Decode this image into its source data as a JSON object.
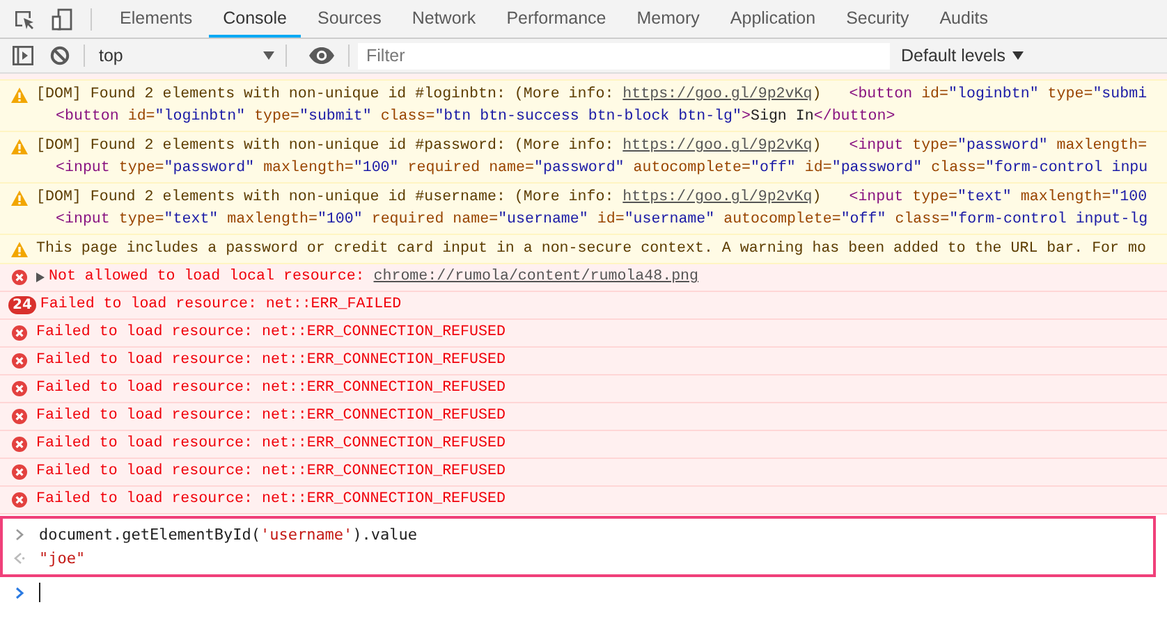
{
  "tabs": [
    {
      "label": "Elements",
      "selected": false
    },
    {
      "label": "Console",
      "selected": true
    },
    {
      "label": "Sources",
      "selected": false
    },
    {
      "label": "Network",
      "selected": false
    },
    {
      "label": "Performance",
      "selected": false
    },
    {
      "label": "Memory",
      "selected": false
    },
    {
      "label": "Application",
      "selected": false
    },
    {
      "label": "Security",
      "selected": false
    },
    {
      "label": "Audits",
      "selected": false
    }
  ],
  "toolbar": {
    "context": "top",
    "filter": {
      "placeholder": "Filter"
    },
    "levels": "Default levels"
  },
  "messages": [
    {
      "kind": "warning",
      "text": "[DOM] Found 2 elements with non-unique id #loginbtn: (More info: ",
      "link": "https://goo.gl/9p2vKq",
      "after_link": ")",
      "snippet": "<button id=\"loginbtn\" type=\"submi",
      "detail": "<button id=\"loginbtn\" type=\"submit\" class=\"btn btn-success btn-block btn-lg\">Sign In</button>"
    },
    {
      "kind": "warning",
      "text": "[DOM] Found 2 elements with non-unique id #password: (More info: ",
      "link": "https://goo.gl/9p2vKq",
      "after_link": ")",
      "snippet": "<input type=\"password\" maxlength=",
      "detail": "<input type=\"password\" maxlength=\"100\" required name=\"password\" autocomplete=\"off\" id=\"password\" class=\"form-control inpu"
    },
    {
      "kind": "warning",
      "text": "[DOM] Found 2 elements with non-unique id #username: (More info: ",
      "link": "https://goo.gl/9p2vKq",
      "after_link": ")",
      "snippet": "<input type=\"text\" maxlength=\"100",
      "detail": "<input type=\"text\" maxlength=\"100\" required name=\"username\" id=\"username\" autocomplete=\"off\" class=\"form-control input-lg"
    },
    {
      "kind": "warning",
      "text": "This page includes a password or credit card input in a non-secure context. A warning has been added to the URL bar. For mo"
    },
    {
      "kind": "error",
      "expanded": false,
      "text": "Not allowed to load local resource: ",
      "link": "chrome://rumola/content/rumola48.png"
    },
    {
      "kind": "error",
      "count": "24",
      "text": "Failed to load resource: net::ERR_FAILED"
    },
    {
      "kind": "error",
      "text": "Failed to load resource: net::ERR_CONNECTION_REFUSED"
    },
    {
      "kind": "error",
      "text": "Failed to load resource: net::ERR_CONNECTION_REFUSED"
    },
    {
      "kind": "error",
      "text": "Failed to load resource: net::ERR_CONNECTION_REFUSED"
    },
    {
      "kind": "error",
      "text": "Failed to load resource: net::ERR_CONNECTION_REFUSED"
    },
    {
      "kind": "error",
      "text": "Failed to load resource: net::ERR_CONNECTION_REFUSED"
    },
    {
      "kind": "error",
      "text": "Failed to load resource: net::ERR_CONNECTION_REFUSED"
    },
    {
      "kind": "error",
      "text": "Failed to load resource: net::ERR_CONNECTION_REFUSED"
    }
  ],
  "evaluation": {
    "highlighted": true,
    "command": "document.getElementById('username').value",
    "result": "\"joe\""
  }
}
